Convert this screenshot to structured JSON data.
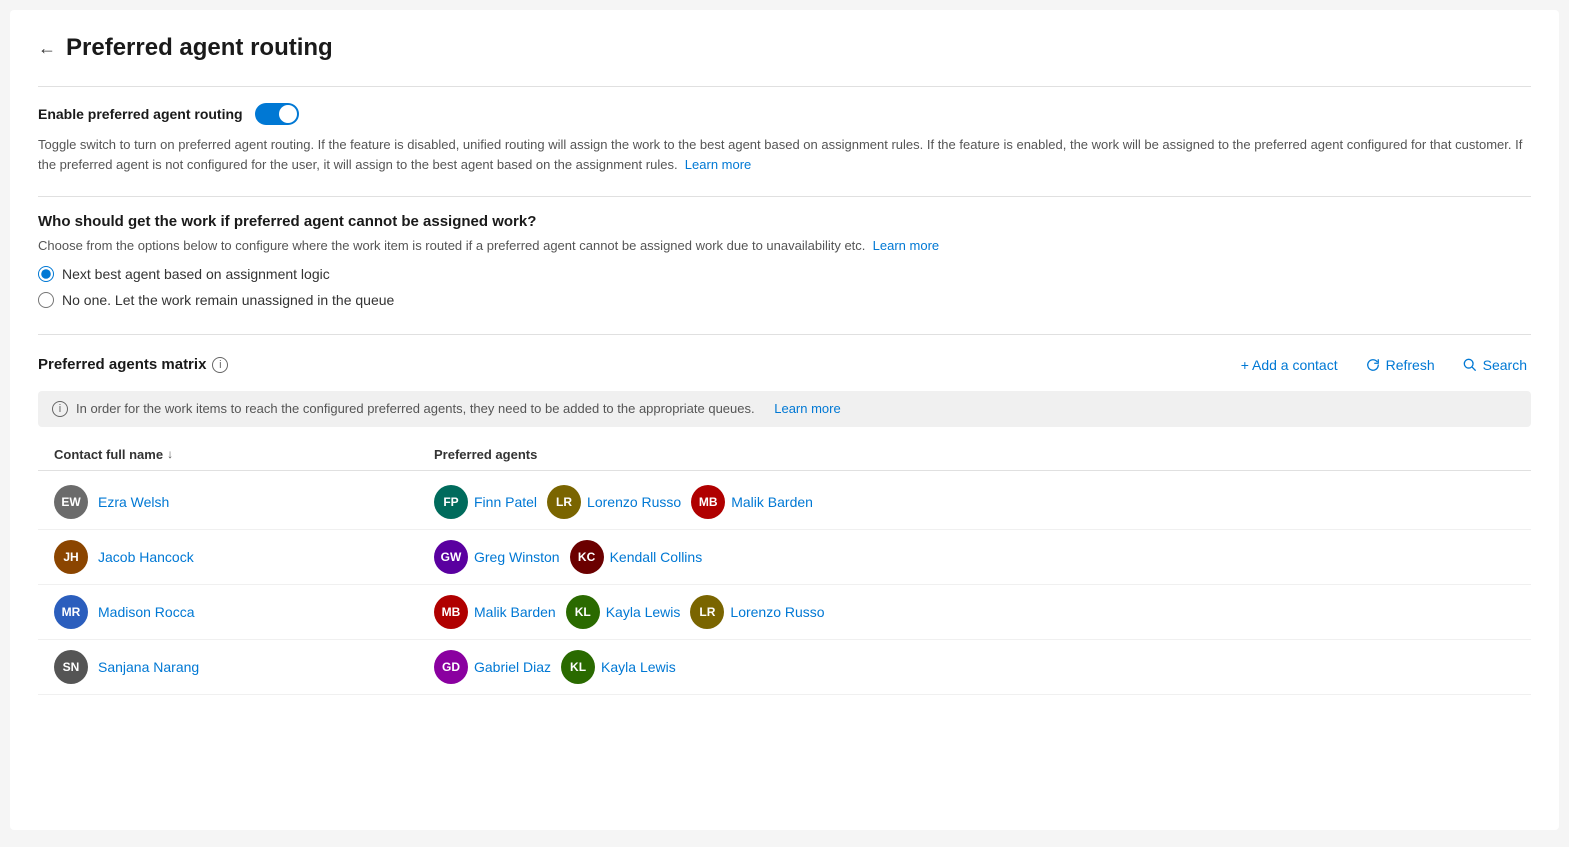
{
  "page": {
    "back_label": "←",
    "title": "Preferred agent routing"
  },
  "toggle_section": {
    "label": "Enable preferred agent routing",
    "enabled": true,
    "description": "Toggle switch to turn on preferred agent routing. If the feature is disabled, unified routing will assign the work to the best agent based on assignment rules. If the feature is enabled, the work will be assigned to the preferred agent configured for that customer. If the preferred agent is not configured for the user, it will assign to the best agent based on the assignment rules.",
    "learn_more": "Learn more"
  },
  "routing_section": {
    "title": "Who should get the work if preferred agent cannot be assigned work?",
    "description": "Choose from the options below to configure where the work item is routed if a preferred agent cannot be assigned work due to unavailability etc.",
    "learn_more": "Learn more",
    "options": [
      {
        "id": "next_best",
        "label": "Next best agent based on assignment logic",
        "selected": true
      },
      {
        "id": "no_one",
        "label": "No one. Let the work remain unassigned in the queue",
        "selected": false
      }
    ]
  },
  "matrix_section": {
    "title": "Preferred agents matrix",
    "info": "i",
    "add_contact_label": "+ Add a contact",
    "refresh_label": "Refresh",
    "search_label": "Search",
    "notice": "In order for the work items to reach the configured preferred agents, they need to be added to the appropriate queues.",
    "notice_learn_more": "Learn more",
    "columns": {
      "contact": "Contact full name",
      "agents": "Preferred agents"
    },
    "rows": [
      {
        "contact": {
          "initials": "EW",
          "name": "Ezra Welsh",
          "color": "#6b6b6b"
        },
        "agents": [
          {
            "initials": "FP",
            "name": "Finn Patel",
            "color": "#006b5c"
          },
          {
            "initials": "LR",
            "name": "Lorenzo Russo",
            "color": "#7a6500"
          },
          {
            "initials": "MB",
            "name": "Malik Barden",
            "color": "#b00000"
          }
        ]
      },
      {
        "contact": {
          "initials": "JH",
          "name": "Jacob Hancock",
          "color": "#8b4500"
        },
        "agents": [
          {
            "initials": "GW",
            "name": "Greg Winston",
            "color": "#5a00a0"
          },
          {
            "initials": "KC",
            "name": "Kendall Collins",
            "color": "#6b0000"
          }
        ]
      },
      {
        "contact": {
          "initials": "MR",
          "name": "Madison Rocca",
          "color": "#2b5ebd"
        },
        "agents": [
          {
            "initials": "MB",
            "name": "Malik Barden",
            "color": "#b00000"
          },
          {
            "initials": "KL",
            "name": "Kayla Lewis",
            "color": "#2a6a00"
          },
          {
            "initials": "LR",
            "name": "Lorenzo Russo",
            "color": "#7a6500"
          }
        ]
      },
      {
        "contact": {
          "initials": "SN",
          "name": "Sanjana Narang",
          "color": "#555555"
        },
        "agents": [
          {
            "initials": "GD",
            "name": "Gabriel Diaz",
            "color": "#8a00a0"
          },
          {
            "initials": "KL",
            "name": "Kayla Lewis",
            "color": "#2a6a00"
          }
        ]
      }
    ]
  }
}
